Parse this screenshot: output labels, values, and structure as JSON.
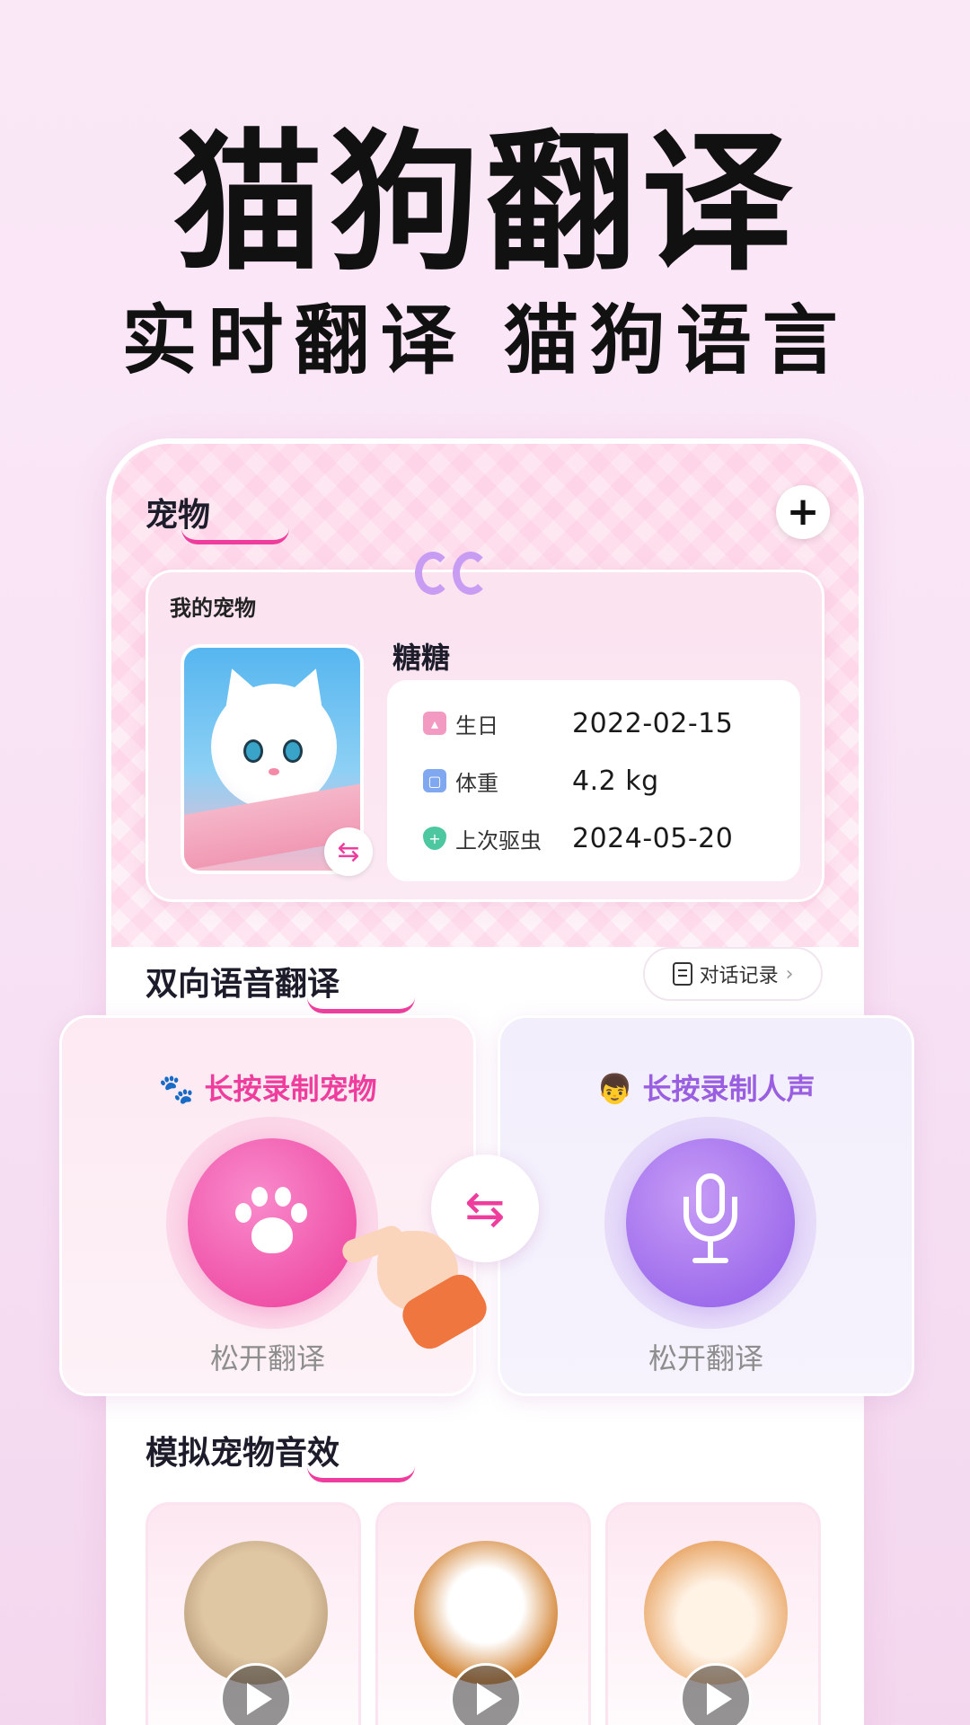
{
  "hero": {
    "title": "猫狗翻译",
    "subtitle": "实时翻译 猫狗语言"
  },
  "pets_section": {
    "title": "宠物",
    "add_icon": "plus-icon",
    "folder_label": "我的宠物",
    "pet": {
      "name": "糖糖",
      "photo": "white-kitten-photo",
      "swap_icon": "swap-arrows-icon",
      "info": [
        {
          "icon": "cake-icon",
          "label": "生日",
          "value": "2022-02-15",
          "color": "#f39ac3"
        },
        {
          "icon": "scale-icon",
          "label": "体重",
          "value": "4.2 kg",
          "color": "#7fa8f0"
        },
        {
          "icon": "shield-plus-icon",
          "label": "上次驱虫",
          "value": "2024-05-20",
          "color": "#4cc7a0"
        }
      ]
    }
  },
  "translate_section": {
    "title": "双向语音翻译",
    "history_label": "对话记录",
    "history_icon": "document-icon",
    "chevron_icon": "chevron-right-icon",
    "pet_card": {
      "icon": "paw-icon",
      "label": "长按录制宠物",
      "button_icon": "paw-icon",
      "release_label": "松开翻译"
    },
    "human_card": {
      "icon": "boy-avatar-icon",
      "label": "长按录制人声",
      "button_icon": "microphone-icon",
      "release_label": "松开翻译"
    },
    "swap_icon": "swap-arrows-icon"
  },
  "sound_section": {
    "title": "模拟宠物音效",
    "items": [
      {
        "animal": "tabby-cat",
        "icon": "play-icon"
      },
      {
        "animal": "puppy-dog",
        "icon": "play-icon"
      },
      {
        "animal": "hamster",
        "icon": "play-icon"
      }
    ]
  },
  "colors": {
    "accent_pink": "#ee3d9c",
    "accent_purple": "#9a5fe0"
  }
}
